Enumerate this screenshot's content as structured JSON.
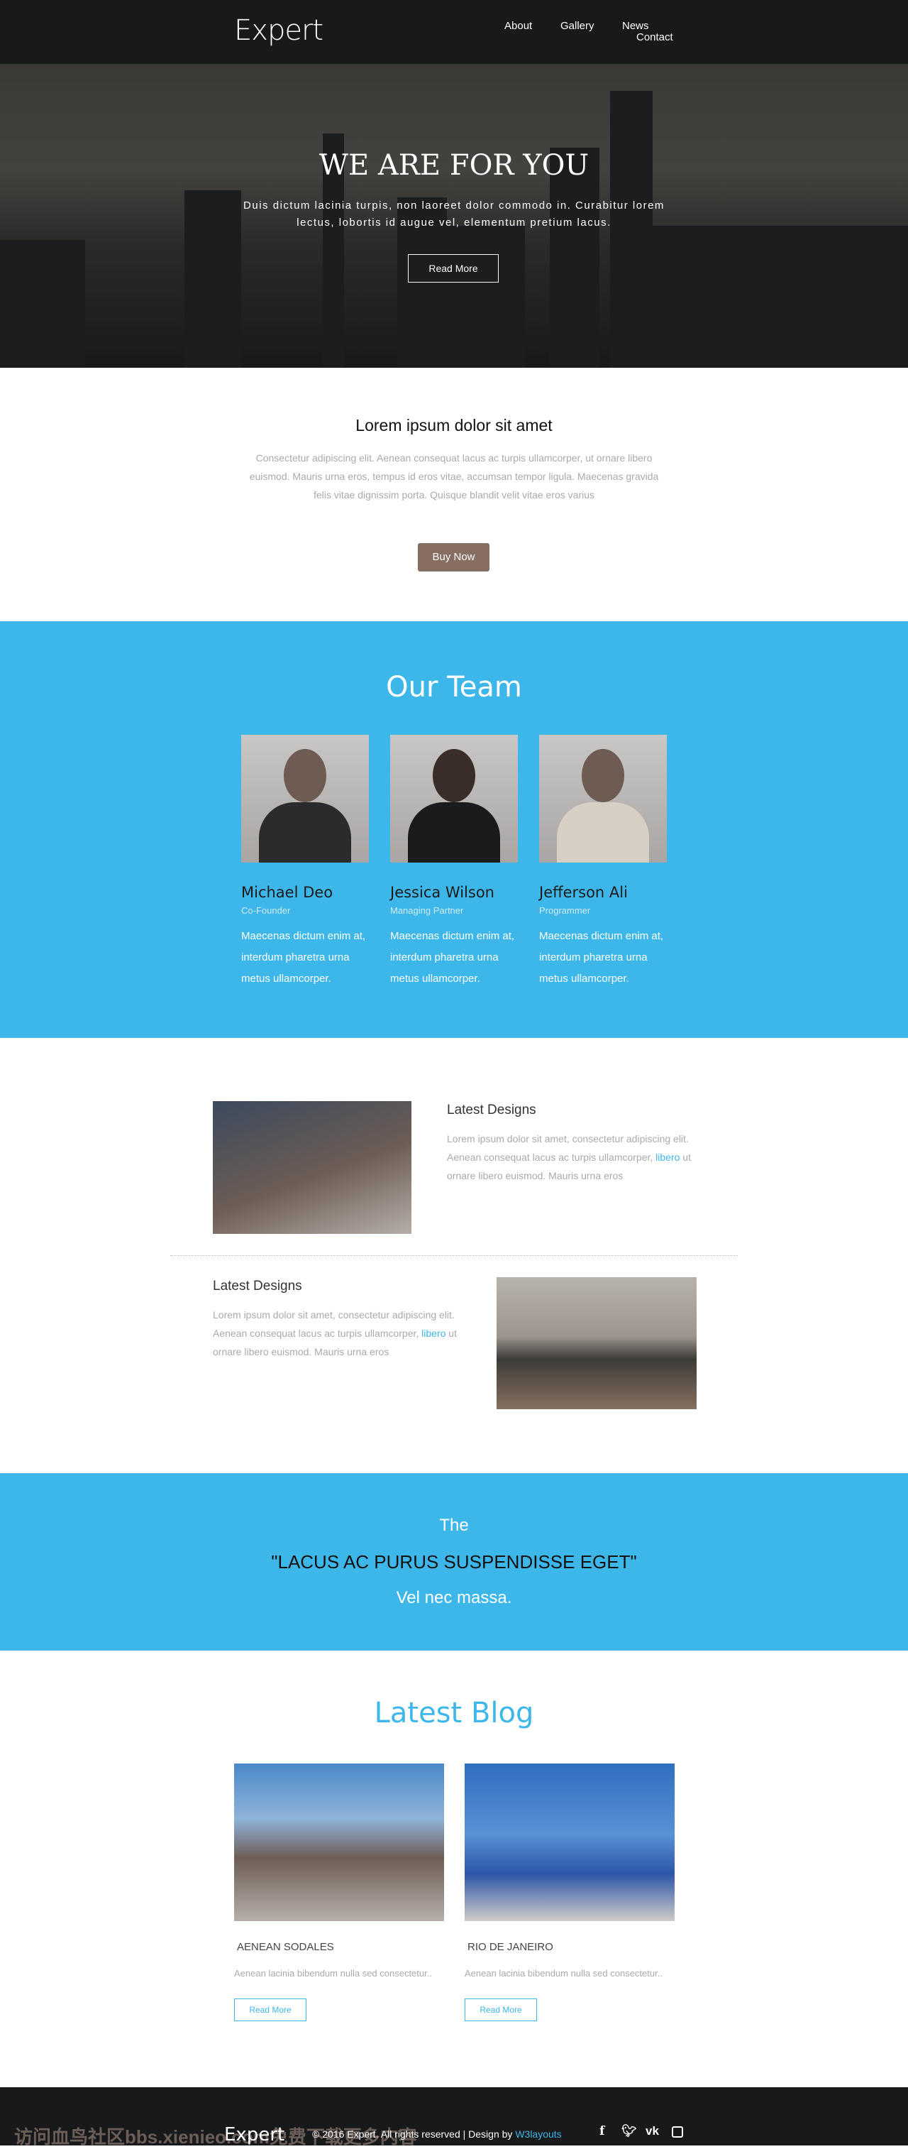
{
  "header": {
    "logo": "Expert",
    "nav": [
      "About",
      "Gallery",
      "News",
      "Contact"
    ]
  },
  "hero": {
    "title": "WE ARE FOR YOU",
    "text": "Duis dictum lacinia turpis, non laoreet dolor commodo in. Curabitur lorem lectus, lobortis id augue vel, elementum pretium lacus.",
    "button": "Read More"
  },
  "intro": {
    "title": "Lorem ipsum dolor sit amet",
    "text": "Consectetur adipiscing elit. Aenean consequat lacus ac turpis ullamcorper, ut ornare libero euismod. Mauris urna eros, tempus id eros vitae, accumsan tempor ligula. Maecenas gravida felis vitae dignissim porta. Quisque blandit velit vitae eros varius",
    "button": "Buy Now"
  },
  "team": {
    "title": "Our Team",
    "members": [
      {
        "name": "Michael Deo",
        "role": "Co-Founder",
        "desc": "Maecenas dictum enim at, interdum pharetra urna metus ullamcorper."
      },
      {
        "name": "Jessica Wilson",
        "role": "Managing Partner",
        "desc": "Maecenas dictum enim at, interdum pharetra urna metus ullamcorper."
      },
      {
        "name": "Jefferson Ali",
        "role": "Programmer",
        "desc": "Maecenas dictum enim at, interdum pharetra urna metus ullamcorper."
      }
    ]
  },
  "designs": [
    {
      "title": "Latest Designs",
      "text_before": "Lorem ipsum dolor sit amet, consectetur adipiscing elit. Aenean consequat lacus ac turpis ullamcorper, ",
      "link": "libero",
      "text_after": " ut ornare libero euismod. Mauris urna eros"
    },
    {
      "title": "Latest Designs",
      "text_before": "Lorem ipsum dolor sit amet, consectetur adipiscing elit. Aenean consequat lacus ac turpis ullamcorper, ",
      "link": "libero",
      "text_after": " ut ornare libero euismod. Mauris urna eros"
    }
  ],
  "quote": {
    "line1": "The",
    "line2": "\"LACUS AC PURUS SUSPENDISSE EGET\"",
    "line3": "Vel nec massa."
  },
  "blog": {
    "title": "Latest Blog",
    "posts": [
      {
        "title": "AENEAN SODALES",
        "desc": "Aenean lacinia bibendum nulla sed consectetur..",
        "button": "Read More"
      },
      {
        "title": "RIO DE JANEIRO",
        "desc": "Aenean lacinia bibendum nulla sed consectetur..",
        "button": "Read More"
      }
    ]
  },
  "footer": {
    "logo": "Expert",
    "copyright": "© 2016 Expert. All rights reserved | Design by ",
    "link": "W3layouts",
    "social": [
      "facebook-icon",
      "twitter-icon",
      "vk-icon",
      "instagram-icon"
    ],
    "watermark": "访问血鸟社区bbs.xienieo.com免费下载更多内容"
  },
  "colors": {
    "accent": "#3db7e9",
    "dark": "#18191b",
    "buy_button": "#876e62"
  }
}
